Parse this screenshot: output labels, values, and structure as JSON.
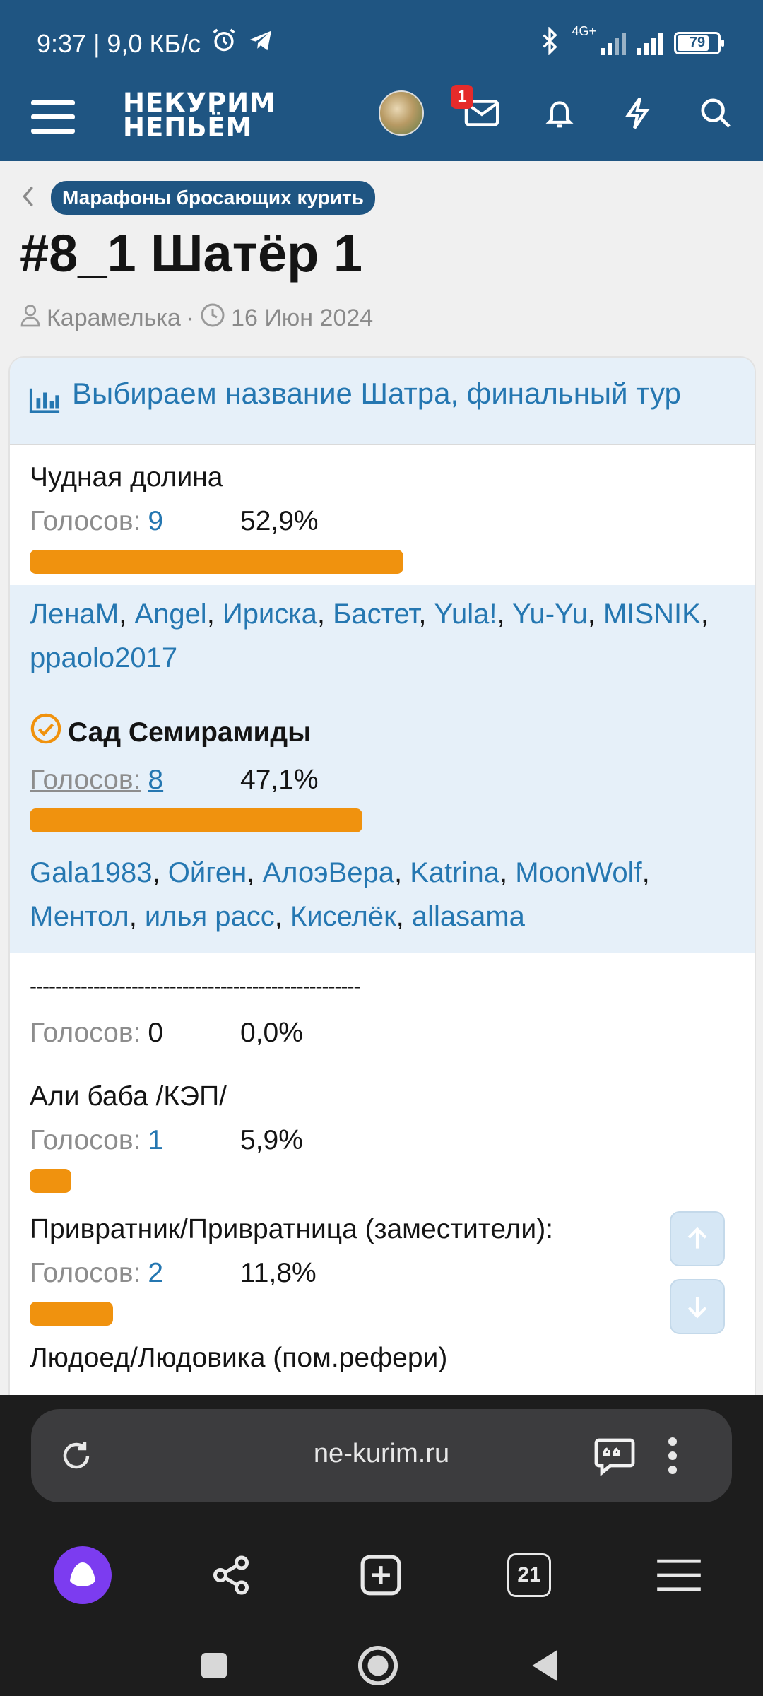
{
  "status_bar": {
    "time_speed": "9:37 | 9,0 КБ/с",
    "network": "4G+",
    "battery": "79",
    "battery_level": 0.79
  },
  "header": {
    "logo_line1": "НЕКУРИМ",
    "logo_line2": "НЕПЬЁМ",
    "messages_badge": "1"
  },
  "breadcrumb": {
    "category": "Марафоны бросающих курить"
  },
  "thread": {
    "title": "#8_1 Шатёр 1",
    "author": "Карамелька",
    "separator": "·",
    "date": "16 Июн 2024"
  },
  "poll": {
    "title": "Выбираем название Шатра, финальный тур",
    "votes_label": "Голосов:",
    "options": [
      {
        "label": "Чудная долина",
        "votes": "9",
        "percent": "52,9%",
        "fraction": 0.529,
        "voters": [
          "ЛенаМ",
          "Angel",
          "Ириска",
          "Бастет",
          "Yula!",
          "Yu-Yu",
          "MISNIK",
          "ppaolo2017"
        ]
      },
      {
        "label": "Сад Семирамиды",
        "votes": "8",
        "percent": "47,1%",
        "fraction": 0.471,
        "chosen": true,
        "voters": [
          "Gala1983",
          "Ойген",
          "АлоэВера",
          "Katrina",
          "MoonWolf",
          "Ментол",
          "илья расс",
          "Киселёк",
          "allasama"
        ]
      },
      {
        "label": "----------------------------------------------------",
        "votes": "0",
        "percent": "0,0%",
        "fraction": 0
      },
      {
        "label": "Али баба /КЭП/",
        "votes": "1",
        "percent": "5,9%",
        "fraction": 0.059
      },
      {
        "label": "Привратник/Привратница (заместители):",
        "votes": "2",
        "percent": "11,8%",
        "fraction": 0.118
      },
      {
        "label": "Людоед/Людовика (пом.рефери)"
      }
    ]
  },
  "browser": {
    "url": "ne-kurim.ru",
    "tabs_count": "21"
  },
  "colors": {
    "brand": "#1f5582",
    "link": "#2577b1",
    "bar": "#f0920e",
    "poll_head_bg": "#e6f0f9"
  }
}
